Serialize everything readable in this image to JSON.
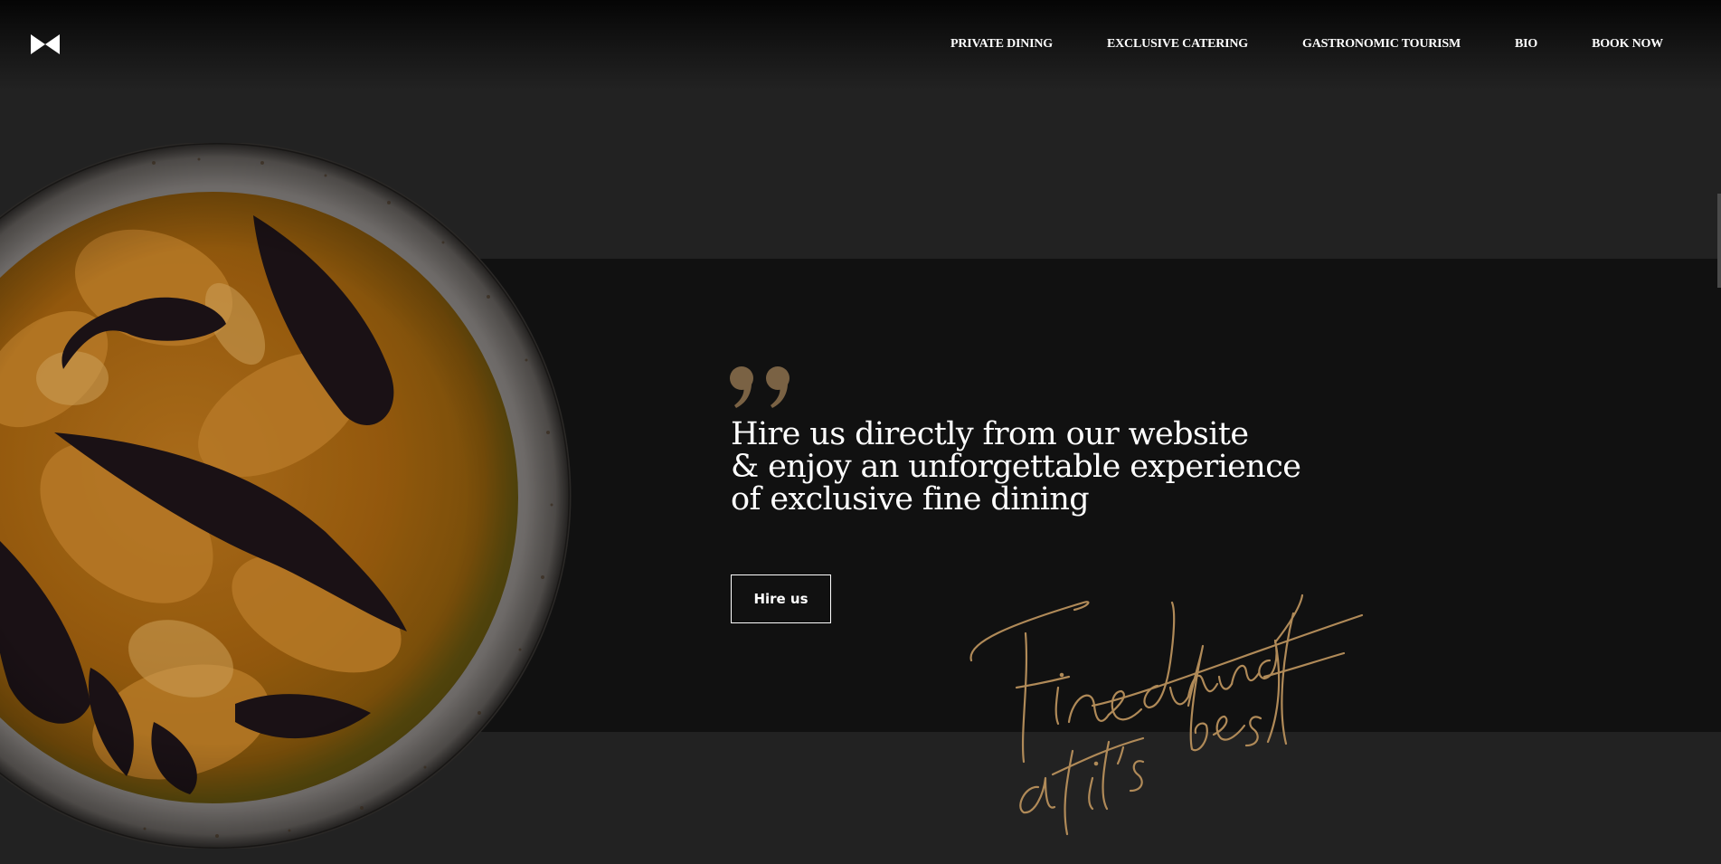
{
  "page": {
    "background": "#222222",
    "band_color": "#111111",
    "accent": "#b08a58"
  },
  "header": {
    "logo_icon": "bowtie-logo-icon",
    "nav": [
      {
        "label": "PRIVATE DINING"
      },
      {
        "label": "EXCLUSIVE CATERING"
      },
      {
        "label": "GASTRONOMIC TOURISM"
      },
      {
        "label": "BIO"
      },
      {
        "label": "BOOK NOW"
      }
    ]
  },
  "hero": {
    "quote_icon": "quote-mark-icon",
    "headline_lines": [
      "Hire us directly from our website",
      "& enjoy an unforgettable experience",
      "of exclusive fine dining"
    ],
    "cta_label": "Hire us",
    "script_lines": [
      "Fine dining",
      "at it's best"
    ]
  }
}
